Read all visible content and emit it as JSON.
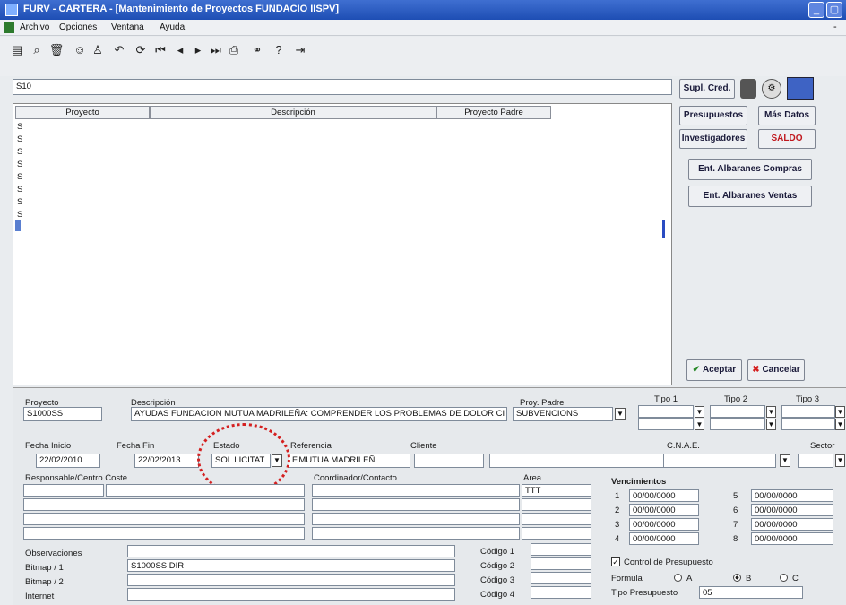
{
  "window": {
    "title": "FURV - CARTERA - [Mantenimiento de Proyectos FUNDACIO IISPV]"
  },
  "menu": {
    "items": [
      "Archivo",
      "Opciones",
      "Ventana",
      "Ayuda"
    ]
  },
  "toolbar": {
    "icons": [
      "print-icon",
      "find-icon",
      "delete-icon",
      "users-icon",
      "user-icon",
      "undo-icon",
      "refresh-icon",
      "first-icon",
      "prev-icon",
      "next-icon",
      "last-icon",
      "printer-icon",
      "binoculars-icon",
      "help-icon",
      "exit-icon"
    ]
  },
  "search": {
    "value": "S10"
  },
  "grid": {
    "columns": [
      "Proyecto",
      "Descripción",
      "Proyecto Padre"
    ],
    "rows": [
      "S",
      "S",
      "S",
      "S",
      "S",
      "S",
      "S",
      "S"
    ]
  },
  "sidebar": {
    "supl_cred": "Supl. Cred.",
    "presupuestos": "Presupuestos",
    "mas_datos": "Más Datos",
    "investigadores": "Investigadores",
    "saldo": "SALDO",
    "ent_compras": "Ent. Albaranes Compras",
    "ent_ventas": "Ent. Albaranes Ventas",
    "aceptar": "Aceptar",
    "cancelar": "Cancelar"
  },
  "detail": {
    "proyecto_label": "Proyecto",
    "proyecto": "S1000SS",
    "descripcion_label": "Descripción",
    "descripcion": "AYUDAS FUNDACION MUTUA MADRILEÑA: COMPRENDER LOS PROBLEMAS DE DOLOR CI",
    "proy_padre_label": "Proy. Padre",
    "proy_padre": "SUBVENCIONS",
    "tipo1_label": "Tipo 1",
    "tipo2_label": "Tipo 2",
    "tipo3_label": "Tipo 3",
    "fecha_inicio_label": "Fecha Inicio",
    "fecha_inicio": "22/02/2010",
    "fecha_fin_label": "Fecha Fin",
    "fecha_fin": "22/02/2013",
    "estado_label": "Estado",
    "estado": "SOL LICITAT",
    "referencia_label": "Referencia",
    "referencia": "F.MUTUA MADRILEÑ",
    "cliente_label": "Cliente",
    "cnae_label": "C.N.A.E.",
    "sector_label": "Sector",
    "responsable_label": "Responsable/Centro Coste",
    "coordinador_label": "Coordinador/Contacto",
    "area_label": "Area",
    "area": "TTT",
    "vencimientos_label": "Vencimientos",
    "vencimientos": [
      {
        "n": "1",
        "v": "00/00/0000"
      },
      {
        "n": "2",
        "v": "00/00/0000"
      },
      {
        "n": "3",
        "v": "00/00/0000"
      },
      {
        "n": "4",
        "v": "00/00/0000"
      },
      {
        "n": "5",
        "v": "00/00/0000"
      },
      {
        "n": "6",
        "v": "00/00/0000"
      },
      {
        "n": "7",
        "v": "00/00/0000"
      },
      {
        "n": "8",
        "v": "00/00/0000"
      }
    ],
    "observaciones_label": "Observaciones",
    "bitmap1_label": "Bitmap / 1",
    "bitmap1": "S1000SS.DIR",
    "bitmap2_label": "Bitmap / 2",
    "internet_label": "Internet",
    "codigo1_label": "Código 1",
    "codigo2_label": "Código 2",
    "codigo3_label": "Código 3",
    "codigo4_label": "Código 4",
    "control_presupuesto_label": "Control de Presupuesto",
    "formula_label": "Formula",
    "opt_a": "A",
    "opt_b": "B",
    "opt_c": "C",
    "tipo_presupuesto_label": "Tipo Presupuesto",
    "tipo_presupuesto": "05"
  },
  "colors": {
    "annotation": "#d42020",
    "saldo": "#c0181e",
    "titlebar": "#2a5cc4"
  }
}
